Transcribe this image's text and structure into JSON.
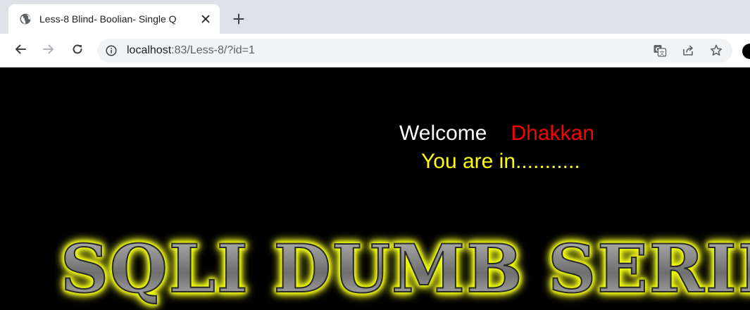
{
  "browser": {
    "tab": {
      "title": "Less-8 Blind- Boolian- Single Q",
      "favicon": "globe-icon",
      "close_icon": "close-icon"
    },
    "new_tab_icon": "plus-icon",
    "nav": {
      "back_icon": "back-arrow-icon",
      "forward_icon": "forward-arrow-icon",
      "reload_icon": "reload-icon"
    },
    "address": {
      "host": "localhost",
      "path": ":83/Less-8/?id=1",
      "info_icon": "info-icon"
    },
    "omnibox_actions": [
      "translate-icon",
      "share-icon",
      "bookmark-star-icon"
    ]
  },
  "page": {
    "welcome": "Welcome",
    "name": "Dhakkan",
    "status": "You are in...........",
    "banner": "SQLI DUMB SERIES",
    "colors": {
      "background": "#000000",
      "welcome": "#ffffff",
      "name": "#ff0000",
      "status": "#ffff00",
      "banner_glow": "#f4ff00"
    }
  }
}
